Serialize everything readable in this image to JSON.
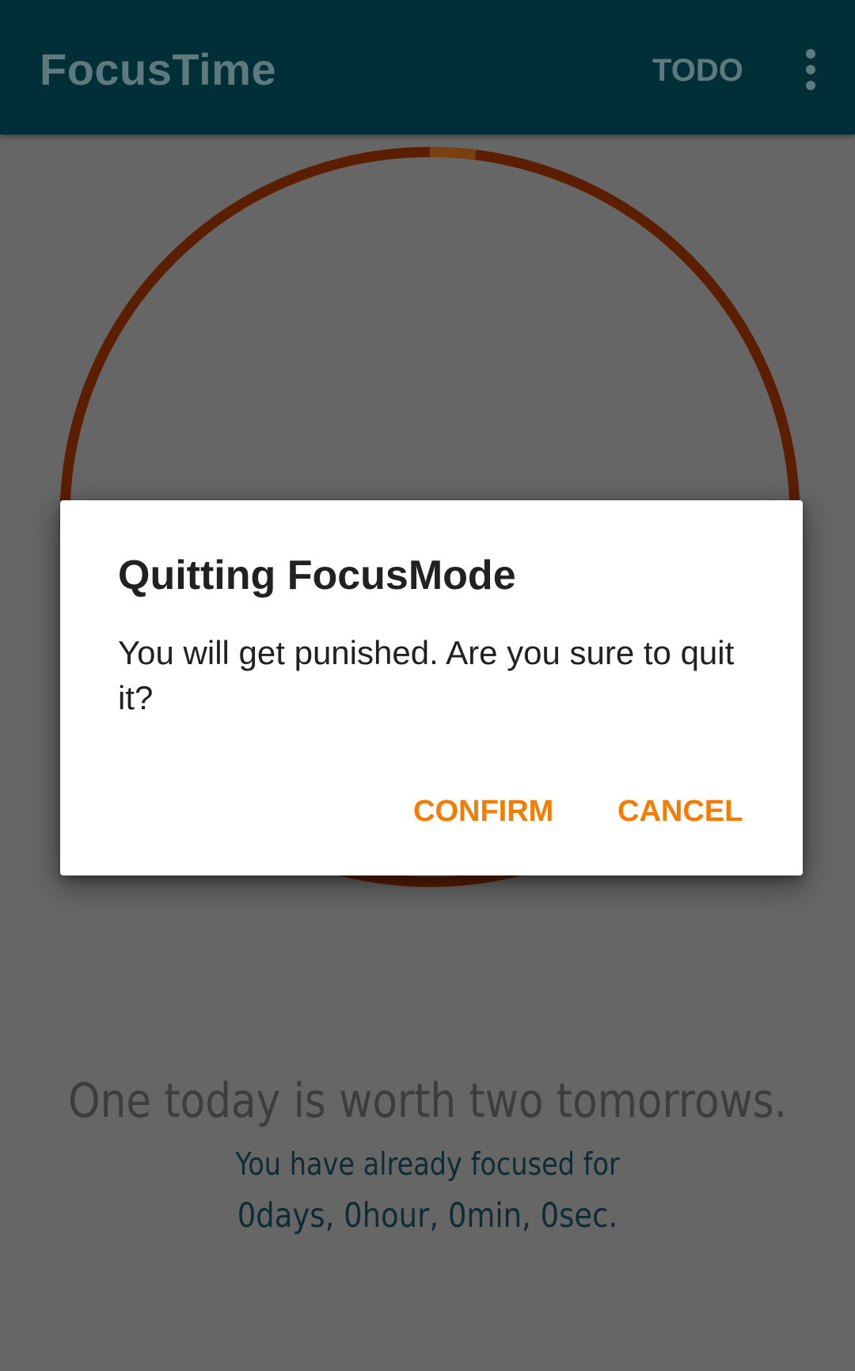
{
  "app_bar": {
    "title": "FocusTime",
    "todo_label": "TODO",
    "overflow_icon": "more-vert-icon"
  },
  "timer_ring": {
    "progress_fraction": 0.02,
    "track_color": "#5c1e00",
    "progress_color": "#7a4010"
  },
  "main": {
    "quote": "One today is worth two tomorrows.",
    "focused_label": "You have already focused for",
    "focused_value": "0days, 0hour, 0min, 0sec."
  },
  "dialog": {
    "title": "Quitting FocusMode",
    "message": "You will get punished. Are you sure to quit it?",
    "confirm_label": "CONFIRM",
    "cancel_label": "CANCEL",
    "accent_color": "#f57c00"
  }
}
